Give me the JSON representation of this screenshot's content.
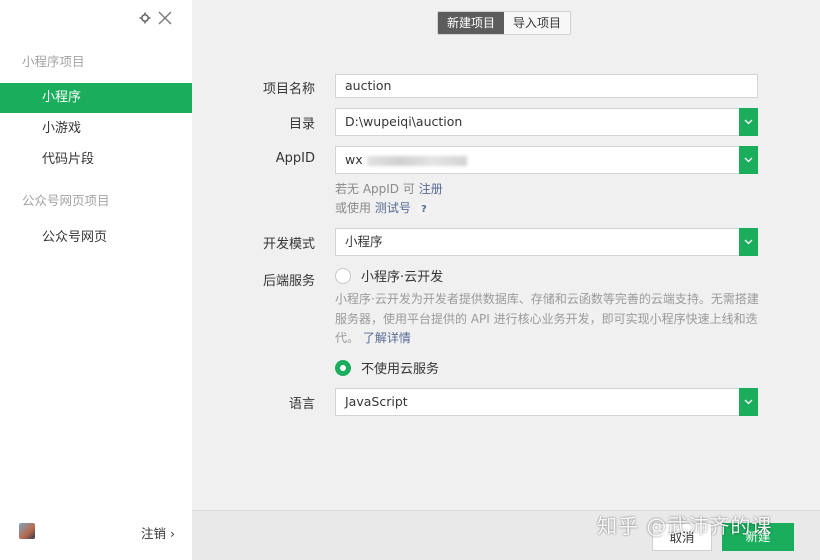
{
  "sidebar": {
    "section_miniprogram": "小程序项目",
    "items_miniprogram": [
      {
        "label": "小程序"
      },
      {
        "label": "小游戏"
      },
      {
        "label": "代码片段"
      }
    ],
    "section_official": "公众号网页项目",
    "items_official": [
      {
        "label": "公众号网页"
      }
    ],
    "logout_label": "注销 ›"
  },
  "tabs": [
    "新建项目",
    "导入项目"
  ],
  "form": {
    "name_label": "项目名称",
    "name_value": "auction",
    "dir_label": "目录",
    "dir_value": "D:\\wupeiqi\\auction",
    "appid_label": "AppID",
    "appid_value": "wx",
    "appid_hint1_prefix": "若无 AppID 可",
    "appid_hint1_link": "注册",
    "appid_hint2_prefix": "或使用",
    "appid_hint2_link": "测试号",
    "help_mark": "?",
    "mode_label": "开发模式",
    "mode_value": "小程序",
    "backend_label": "后端服务",
    "backend_option_cloud": "小程序·云开发",
    "backend_desc": "小程序·云开发为开发者提供数据库、存储和云函数等完善的云端支持。无需搭建服务器，使用平台提供的 API 进行核心业务开发，即可实现小程序快速上线和迭代。",
    "backend_desc_link": "了解详情",
    "backend_option_none": "不使用云服务",
    "backend_selected": "不使用云服务",
    "lang_label": "语言",
    "lang_value": "JavaScript"
  },
  "footer": {
    "cancel_label": "取消",
    "create_label": "新建"
  },
  "watermark": "知乎 @武沛齐的课",
  "colors": {
    "accent": "#1aad5c",
    "link": "#576b95",
    "tab_active_bg": "#5c5c5c"
  }
}
